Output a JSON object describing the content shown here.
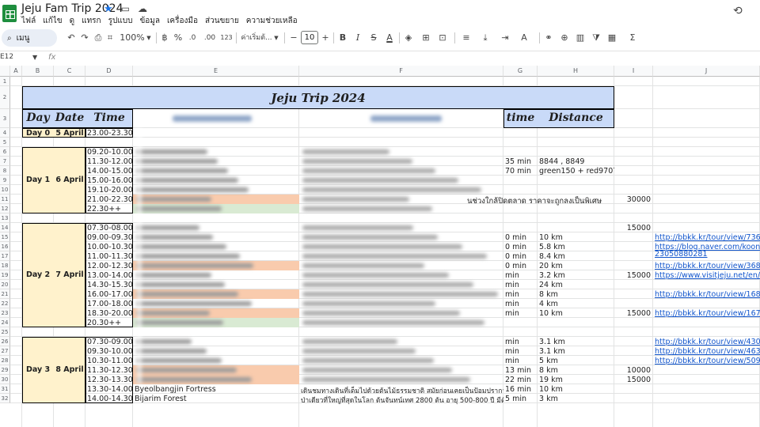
{
  "app": {
    "doc_title": "Jeju Fam Trip 2024",
    "menu": [
      "ไฟล์",
      "แก้ไข",
      "ดู",
      "แทรก",
      "รูปแบบ",
      "ข้อมูล",
      "เครื่องมือ",
      "ส่วนขยาย",
      "ความช่วยเหลือ"
    ],
    "icons": {
      "star": "star-icon",
      "folder": "move-icon",
      "cloud": "cloud-saved-icon",
      "history": "history-icon"
    }
  },
  "toolbar": {
    "search_label": "เมนู",
    "zoom": "100%",
    "percent": "%",
    "decimal_less": ".0",
    "decimal_more": ".00",
    "number_format": "123",
    "font": "ค่าเริ่มต้...",
    "font_size": "10",
    "bold": "B",
    "italic": "I",
    "strike": "S",
    "text_color": "A",
    "sigma": "Σ"
  },
  "formula_bar": {
    "name_box": "E12",
    "fx": "fx"
  },
  "sheet": {
    "columns": [
      "A",
      "B",
      "C",
      "D",
      "E",
      "F",
      "G",
      "H",
      "I",
      "J"
    ],
    "rows": [
      "1",
      "2",
      "3",
      "4",
      "5",
      "6",
      "7",
      "8",
      "9",
      "10",
      "11",
      "12",
      "13",
      "14",
      "15",
      "16",
      "17",
      "18",
      "19",
      "20",
      "21",
      "22",
      "23",
      "24",
      "25",
      "26",
      "27",
      "28",
      "29",
      "30",
      "31",
      "32"
    ],
    "title": "Jeju Trip 2024",
    "headers": {
      "day": "Day",
      "date": "Date",
      "time": "Time",
      "place": "Place",
      "detail": "Detail",
      "dur": "time",
      "distance": "Distance"
    },
    "day0": {
      "day": "Day 0",
      "date": "5 April",
      "time": "23.00-23.30"
    },
    "day1": {
      "day": "Day 1",
      "date": "6 April",
      "times": [
        "09.20-10.00",
        "11.30-12.00",
        "14.00-15.00",
        "15.00-16.00",
        "19.10-20.00",
        "21.00-22.30",
        "22.30++"
      ],
      "durations": [
        "35 min",
        "70 min"
      ],
      "distances": [
        "8844 , 8849",
        "green150 + red9707"
      ],
      "detail_tail": "นช่วงใกล้ปิดตลาด ราคาจะถูกลงเป็นพิเศษ",
      "cost": "30000"
    },
    "day2": {
      "day": "Day 2",
      "date": "7 April",
      "times": [
        "07.30-08.00",
        "09.00-09.30",
        "10.00-10.30",
        "11.00-11.30",
        "12.00-12.30",
        "13.00-14.00",
        "14.30-15.30",
        "16.00-17.00",
        "17.00-18.00",
        "18.30-20.00",
        "20.30++"
      ],
      "durations": [
        "0 min",
        "0 min",
        "0 min",
        "0 min",
        "min",
        "min",
        "min",
        "min",
        "min",
        "min"
      ],
      "distances": [
        "10 km",
        "5.8 km",
        "8.4 km",
        "20 km",
        "3.2 km",
        "24 km",
        "8 km",
        "4 km",
        "10 km"
      ],
      "costs": [
        "15000",
        "15000",
        "15000"
      ],
      "links": [
        "http://bbkk.kr/tour/view/736",
        "https://blog.naver.com/kooni/2",
        "23050880281",
        "http://bbkk.kr/tour/view/3689",
        "https://www.visitjeju.net/en/det",
        "http://bbkk.kr/tour/view/1682",
        "http://bbkk.kr/tour/view/1674"
      ]
    },
    "day3": {
      "day": "Day 3",
      "date": "8 April",
      "times": [
        "07.30-09.00",
        "09.30-10.00",
        "10.30-11.00",
        "11.30-12.30",
        "12.30-13.30",
        "13.30-14.00",
        "14.00-14.30"
      ],
      "places": [
        "Byeolbangjin Fortress",
        "Bijarim Forest"
      ],
      "details": [
        "เดินชมทางเดินที่เต็มไปด้วยต้นไม้ธรรมชาติ สมัยก่อนเคยเป็นป้อมปราการของญี่ปุ่น",
        "ป่าเดียวที่ใหญ่ที่สุดในโลก ต้นจันทน์เทศ 2800 ต้น อายุ 500-800 ปี มีต้นไ"
      ],
      "durations": [
        "min",
        "min",
        "min",
        "13 min",
        "22 min",
        "16 min",
        "5 min"
      ],
      "distances": [
        "3.1 km",
        "3.1 km",
        "5 km",
        "8 km",
        "19 km",
        "10 km",
        "3 km"
      ],
      "costs": [
        "10000",
        "15000"
      ],
      "links": [
        "http://bbkk.kr/tour/view/4307",
        "http://bbkk.kr/tour/view/4635",
        "http://bbkk.kr/tour/view/5098"
      ]
    }
  },
  "colors": {
    "header_blue": "#c9daf8",
    "day_yellow": "#fff2cc",
    "place_orange": "#f9cbad",
    "place_green": "#d9ead3",
    "link_blue": "#1155cc"
  }
}
